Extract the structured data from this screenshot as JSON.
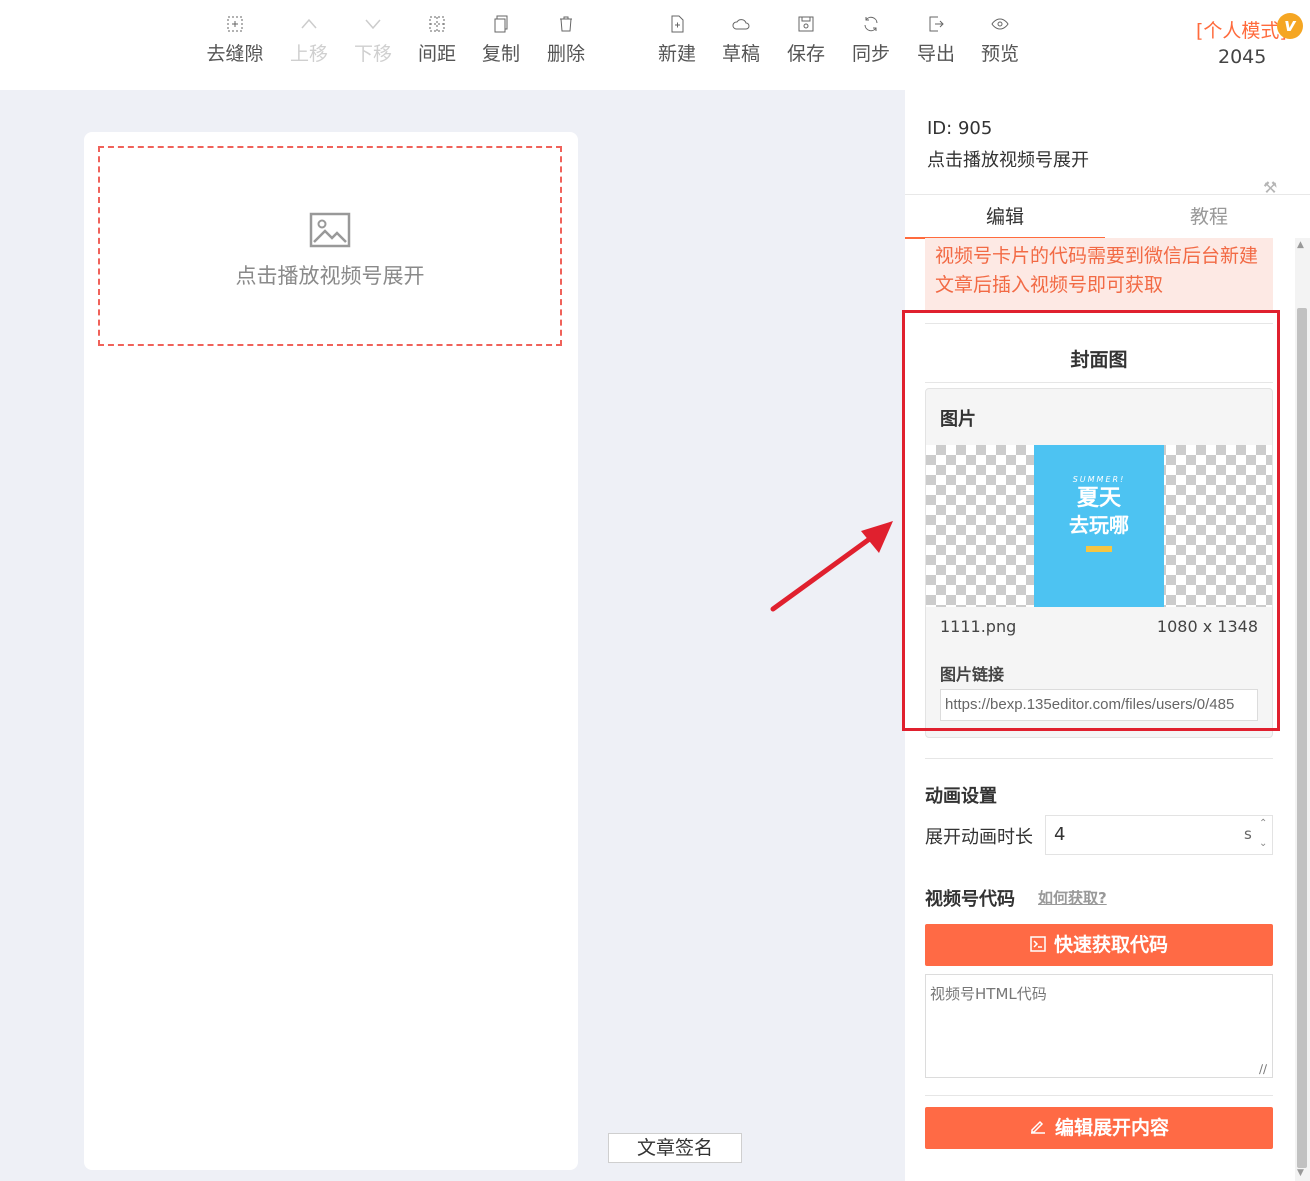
{
  "toolbar": {
    "items": [
      {
        "label": "去缝隙",
        "icon": "remove-gap-icon",
        "disabled": false
      },
      {
        "label": "上移",
        "icon": "chevron-up-icon",
        "disabled": true
      },
      {
        "label": "下移",
        "icon": "chevron-down-icon",
        "disabled": true
      },
      {
        "label": "间距",
        "icon": "spacing-icon",
        "disabled": false
      },
      {
        "label": "复制",
        "icon": "copy-icon",
        "disabled": false
      },
      {
        "label": "删除",
        "icon": "trash-icon",
        "disabled": false
      },
      {
        "label": "新建",
        "icon": "new-file-icon",
        "disabled": false
      },
      {
        "label": "草稿",
        "icon": "cloud-icon",
        "disabled": false
      },
      {
        "label": "保存",
        "icon": "save-icon",
        "disabled": false
      },
      {
        "label": "同步",
        "icon": "sync-icon",
        "disabled": false
      },
      {
        "label": "导出",
        "icon": "export-icon",
        "disabled": false
      },
      {
        "label": "预览",
        "icon": "eye-icon",
        "disabled": false
      }
    ],
    "mode": "[个人模式]",
    "vip_badge": "v",
    "count": "2045"
  },
  "canvas": {
    "placeholder_text": "点击播放视频号展开",
    "signature_button": "文章签名"
  },
  "panel": {
    "id_line": "ID: 905",
    "title": "点击播放视频号展开",
    "tabs": [
      "编辑",
      "教程"
    ],
    "notice": "视频号卡片的代码需要到微信后台新建文章后插入视频号即可获取",
    "cover": {
      "section_title": "封面图",
      "card_title": "图片",
      "poster": {
        "en": "SUMMER!",
        "zh1": "夏天",
        "zh2": "去玩哪"
      },
      "file_name": "1111.png",
      "file_dims": "1080 x 1348",
      "link_label": "图片链接",
      "link_value": "https://bexp.135editor.com/files/users/0/485"
    },
    "animation": {
      "title": "动画设置",
      "label": "展开动画时长",
      "value": "4",
      "unit": "s"
    },
    "code": {
      "title": "视频号代码",
      "help_link": "如何获取?",
      "quick_button": "快速获取代码",
      "textarea_placeholder": "视频号HTML代码",
      "edit_button": "编辑展开内容"
    }
  },
  "colors": {
    "accent": "#ff6a45",
    "highlight_box": "#e0202e",
    "notice_bg": "#fde9e4"
  }
}
